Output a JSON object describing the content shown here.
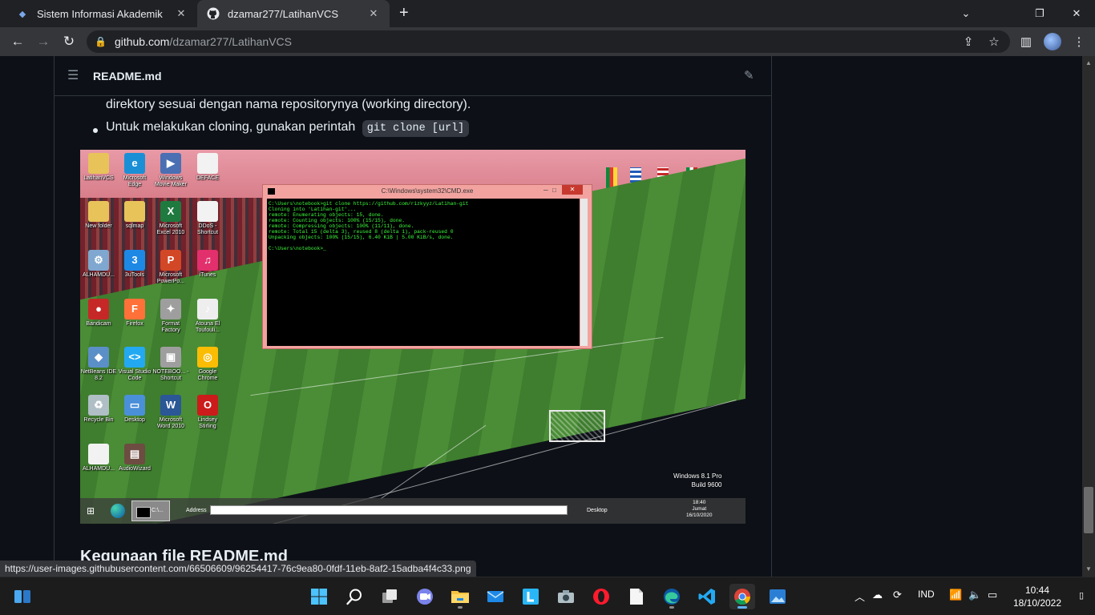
{
  "browser": {
    "tabs": [
      {
        "title": "Sistem Informasi Akademik",
        "active": false
      },
      {
        "title": "dzamar277/LatihanVCS",
        "active": true
      }
    ],
    "url_host": "github.com",
    "url_path": "/dzamar277/LatihanVCS",
    "status_link": "https://user-images.githubusercontent.com/66506609/96254417-76c9ea80-0fdf-11eb-8af2-15adba4f4c33.png"
  },
  "readme": {
    "filename": "README.md",
    "line_continued": "direktory sesuai dengan nama repositorynya (working directory).",
    "bullet_text": "Untuk melakukan cloning, gunakan perintah",
    "bullet_code": "git clone [url]",
    "next_heading": "Kegunaan file README.md"
  },
  "embedded_screenshot": {
    "cmd_title": "C:\\Windows\\system32\\CMD.exe",
    "cmd_output": "C:\\Users\\notebook>git clone https://github.com/rizkyyz/Latihan-git\nCloning into 'Latihan-git'...\nremote: Enumerating objects: 15, done.\nremote: Counting objects: 100% (15/15), done.\nremote: Compressing objects: 100% (11/11), done.\nremote: Total 15 (delta 3), reused 8 (delta 1), pack-reused 0\nUnpacking objects: 100% (15/15), 6.40 KiB | 5.00 KiB/s, done.\n\nC:\\Users\\notebook>_",
    "desktop_icons": [
      {
        "label": "LatihanVCS",
        "icon": "folder-icon",
        "color": "#e8c35a",
        "glyph": ""
      },
      {
        "label": "Microsoft Edge",
        "icon": "edge-icon",
        "color": "#1a8fd6",
        "glyph": "e"
      },
      {
        "label": "Windows Movie Maker",
        "icon": "movie-maker-icon",
        "color": "#4a6fb3",
        "glyph": "▶"
      },
      {
        "label": "DEFACE",
        "icon": "document-icon",
        "color": "#f2f2f2",
        "glyph": ""
      },
      {
        "label": "New folder",
        "icon": "folder-icon",
        "color": "#e8c35a",
        "glyph": ""
      },
      {
        "label": "sqlmap",
        "icon": "folder-icon",
        "color": "#e8c35a",
        "glyph": ""
      },
      {
        "label": "Microsoft Excel 2010",
        "icon": "excel-icon",
        "color": "#1f7a3f",
        "glyph": "X"
      },
      {
        "label": "DDoS - Shortcut",
        "icon": "document-icon",
        "color": "#f2f2f2",
        "glyph": ""
      },
      {
        "label": "ALHAMDU...",
        "icon": "gear-icon",
        "color": "#7fa7cf",
        "glyph": "⚙"
      },
      {
        "label": "3uTools",
        "icon": "3utools-icon",
        "color": "#1e88e5",
        "glyph": "3"
      },
      {
        "label": "Microsoft PowerPo...",
        "icon": "powerpoint-icon",
        "color": "#d24726",
        "glyph": "P"
      },
      {
        "label": "iTunes",
        "icon": "itunes-icon",
        "color": "#e1306c",
        "glyph": "♫"
      },
      {
        "label": "Bandicam",
        "icon": "bandicam-icon",
        "color": "#c62828",
        "glyph": "●"
      },
      {
        "label": "Firefox",
        "icon": "firefox-icon",
        "color": "#ff7139",
        "glyph": "F"
      },
      {
        "label": "Format Factory",
        "icon": "format-factory-icon",
        "color": "#9e9e9e",
        "glyph": "✦"
      },
      {
        "label": "Atouna El Toufouli...",
        "icon": "mp3-icon",
        "color": "#eeeeee",
        "glyph": "♪"
      },
      {
        "label": "NetBeans IDE 8.2",
        "icon": "netbeans-icon",
        "color": "#5b8fc7",
        "glyph": "◆"
      },
      {
        "label": "Visual Studio Code",
        "icon": "vscode-icon",
        "color": "#23a9f2",
        "glyph": "<>"
      },
      {
        "label": "NOTEBOO... - Shortcut",
        "icon": "computer-icon",
        "color": "#9e9e9e",
        "glyph": "▣"
      },
      {
        "label": "Google Chrome",
        "icon": "chrome-icon",
        "color": "#fbbc04",
        "glyph": "◎"
      },
      {
        "label": "Recycle Bin",
        "icon": "recycle-bin-icon",
        "color": "#b0bec5",
        "glyph": "♻"
      },
      {
        "label": "Desktop",
        "icon": "desktop-icon",
        "color": "#4a90d9",
        "glyph": "▭"
      },
      {
        "label": "Microsoft Word 2010",
        "icon": "word-icon",
        "color": "#2b5797",
        "glyph": "W"
      },
      {
        "label": "Lindsey Stirling",
        "icon": "opera-icon",
        "color": "#cc1b1b",
        "glyph": "O"
      },
      {
        "label": "ALHAMDU...",
        "icon": "document-icon",
        "color": "#f2f2f2",
        "glyph": ""
      },
      {
        "label": "AudioWizard",
        "icon": "audiowizard-icon",
        "color": "#6d4c41",
        "glyph": "▤"
      }
    ],
    "taskbar_cmd_label": "C:\\...",
    "address_label": "Address",
    "desktop_label": "Desktop",
    "clock_time": "18:40",
    "clock_day": "Jumat",
    "clock_date": "16/10/2020",
    "watermark_line1": "Windows 8.1 Pro",
    "watermark_line2": "Build 9600"
  },
  "taskbar": {
    "language": "IND",
    "time": "10:44",
    "date": "18/10/2022"
  }
}
